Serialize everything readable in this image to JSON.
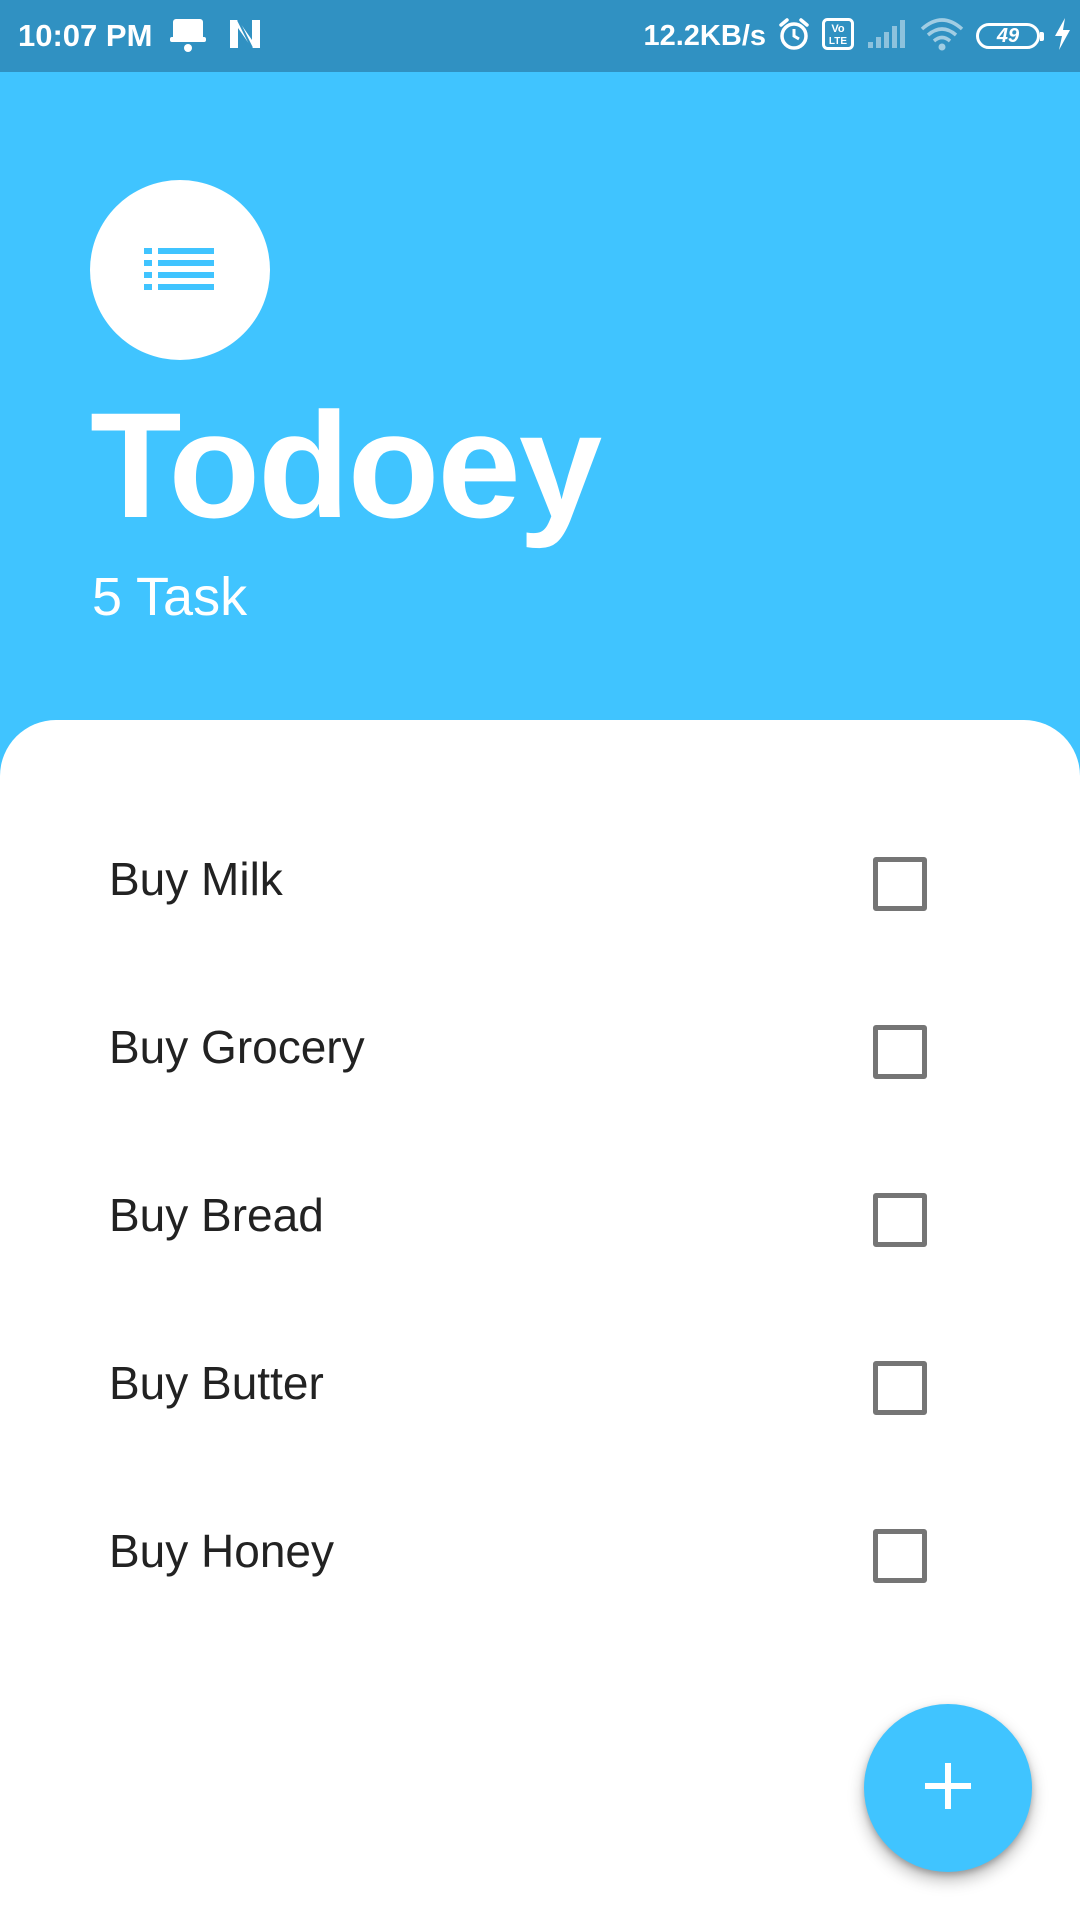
{
  "status_bar": {
    "time": "10:07 PM",
    "network_speed": "12.2KB/s",
    "battery_level": "49",
    "icons": [
      "notification-bell-icon",
      "n-app-icon",
      "alarm-icon",
      "volte-icon",
      "signal-icon",
      "wifi-icon",
      "battery-icon",
      "charging-icon"
    ]
  },
  "header": {
    "icon": "list-icon",
    "title": "Todoey",
    "task_count": "5 Task"
  },
  "tasks": [
    {
      "label": "Buy Milk",
      "checked": false
    },
    {
      "label": "Buy Grocery",
      "checked": false
    },
    {
      "label": "Buy Bread",
      "checked": false
    },
    {
      "label": "Buy Butter",
      "checked": false
    },
    {
      "label": "Buy Honey",
      "checked": false
    }
  ],
  "fab": {
    "icon": "plus-icon"
  },
  "colors": {
    "accent": "#40c4ff",
    "status_bar": "#3091c2",
    "checkbox_border": "#757575",
    "text": "#222222"
  }
}
